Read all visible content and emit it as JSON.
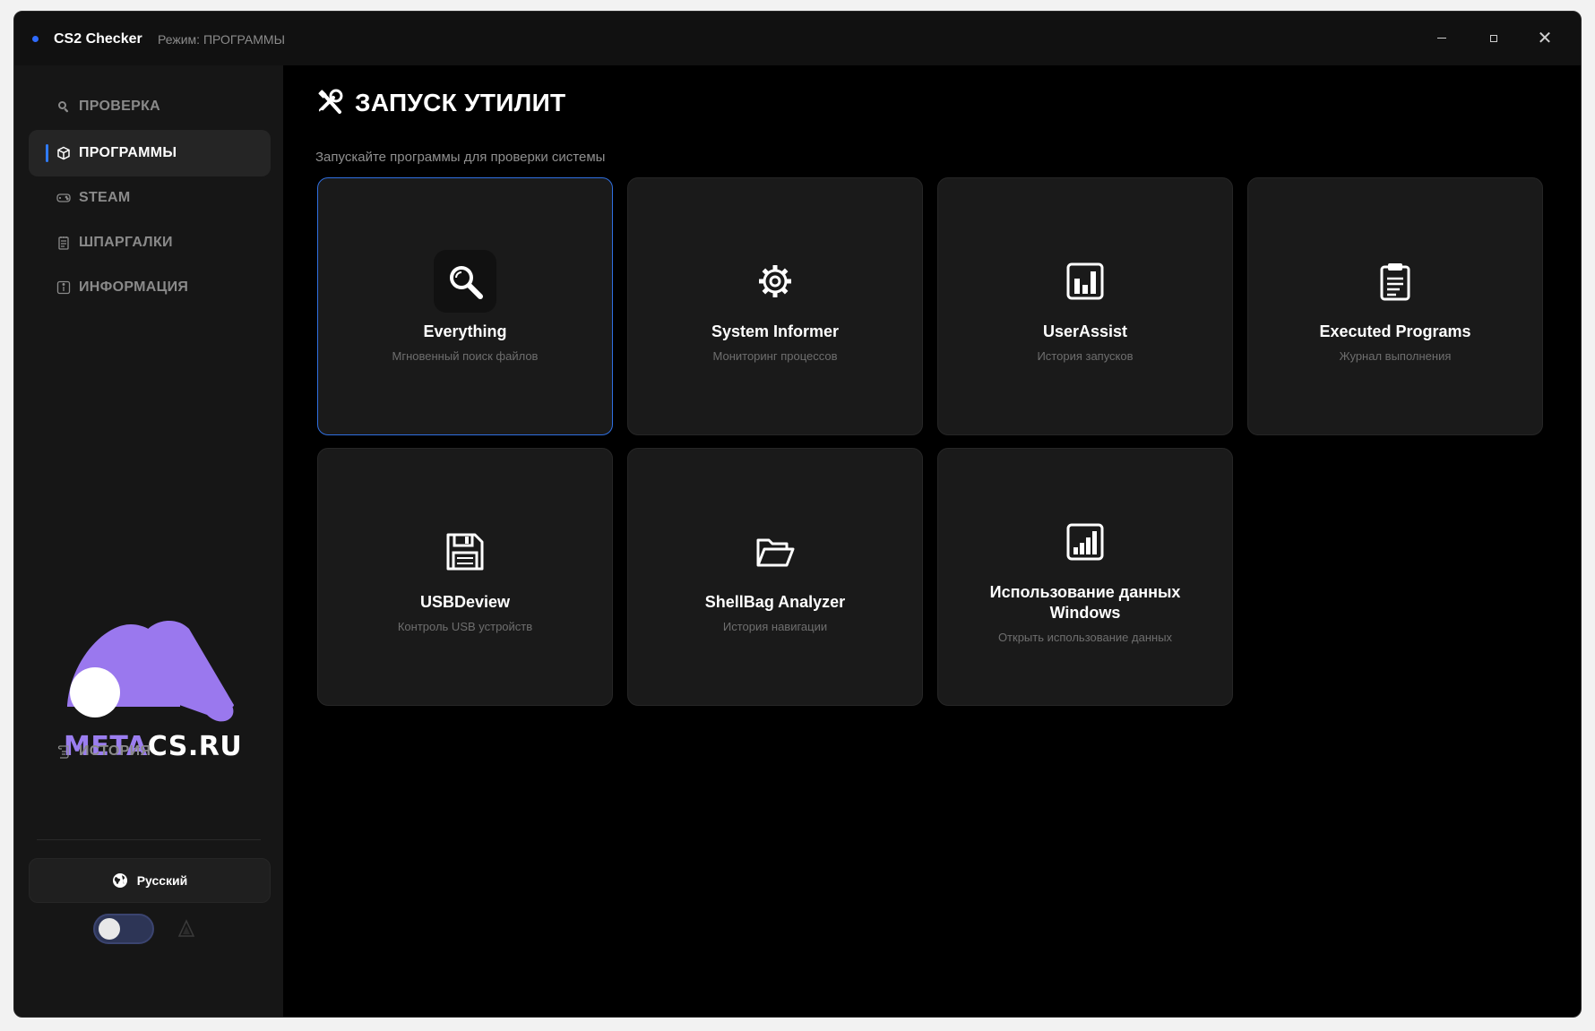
{
  "titlebar": {
    "app_title": "CS2 Checker",
    "mode_text": "Режим: ПРОГРАММЫ",
    "accent_color": "#2f6bff"
  },
  "sidebar": {
    "items": [
      {
        "label": "ПРОВЕРКА",
        "icon": "search-icon",
        "active": false
      },
      {
        "label": "ПРОГРАММЫ",
        "icon": "cube-icon",
        "active": true
      },
      {
        "label": "STEAM",
        "icon": "gamepad-icon",
        "active": false
      },
      {
        "label": "ШПАРГАЛКИ",
        "icon": "notepad-icon",
        "active": false
      },
      {
        "label": "ИНФОРМАЦИЯ",
        "icon": "info-icon",
        "active": false
      }
    ],
    "history_label": "ИСТОРИЯ",
    "logo": {
      "part1": "META",
      "part2": "CS.RU",
      "brand_color": "#9b7ef0"
    },
    "language_label": "Русский",
    "theme_toggle_on": false
  },
  "main": {
    "title": "ЗАПУСК УТИЛИТ",
    "subtitle": "Запускайте программы для проверки системы",
    "cards": [
      {
        "title": "Everything",
        "desc": "Мгновенный поиск файлов",
        "icon": "magnifier-icon",
        "selected": true
      },
      {
        "title": "System Informer",
        "desc": "Мониторинг процессов",
        "icon": "gear-icon",
        "selected": false
      },
      {
        "title": "UserAssist",
        "desc": "История запусков",
        "icon": "bar-chart-icon",
        "selected": false
      },
      {
        "title": "Executed Programs",
        "desc": "Журнал выполнения",
        "icon": "clipboard-icon",
        "selected": false
      },
      {
        "title": "USBDeview",
        "desc": "Контроль USB устройств",
        "icon": "floppy-disk-icon",
        "selected": false
      },
      {
        "title": "ShellBag Analyzer",
        "desc": "История навигации",
        "icon": "folder-open-icon",
        "selected": false
      },
      {
        "title": "Использование данных Windows",
        "desc": "Открыть использование данных",
        "icon": "data-usage-chart-icon",
        "selected": false
      }
    ]
  }
}
